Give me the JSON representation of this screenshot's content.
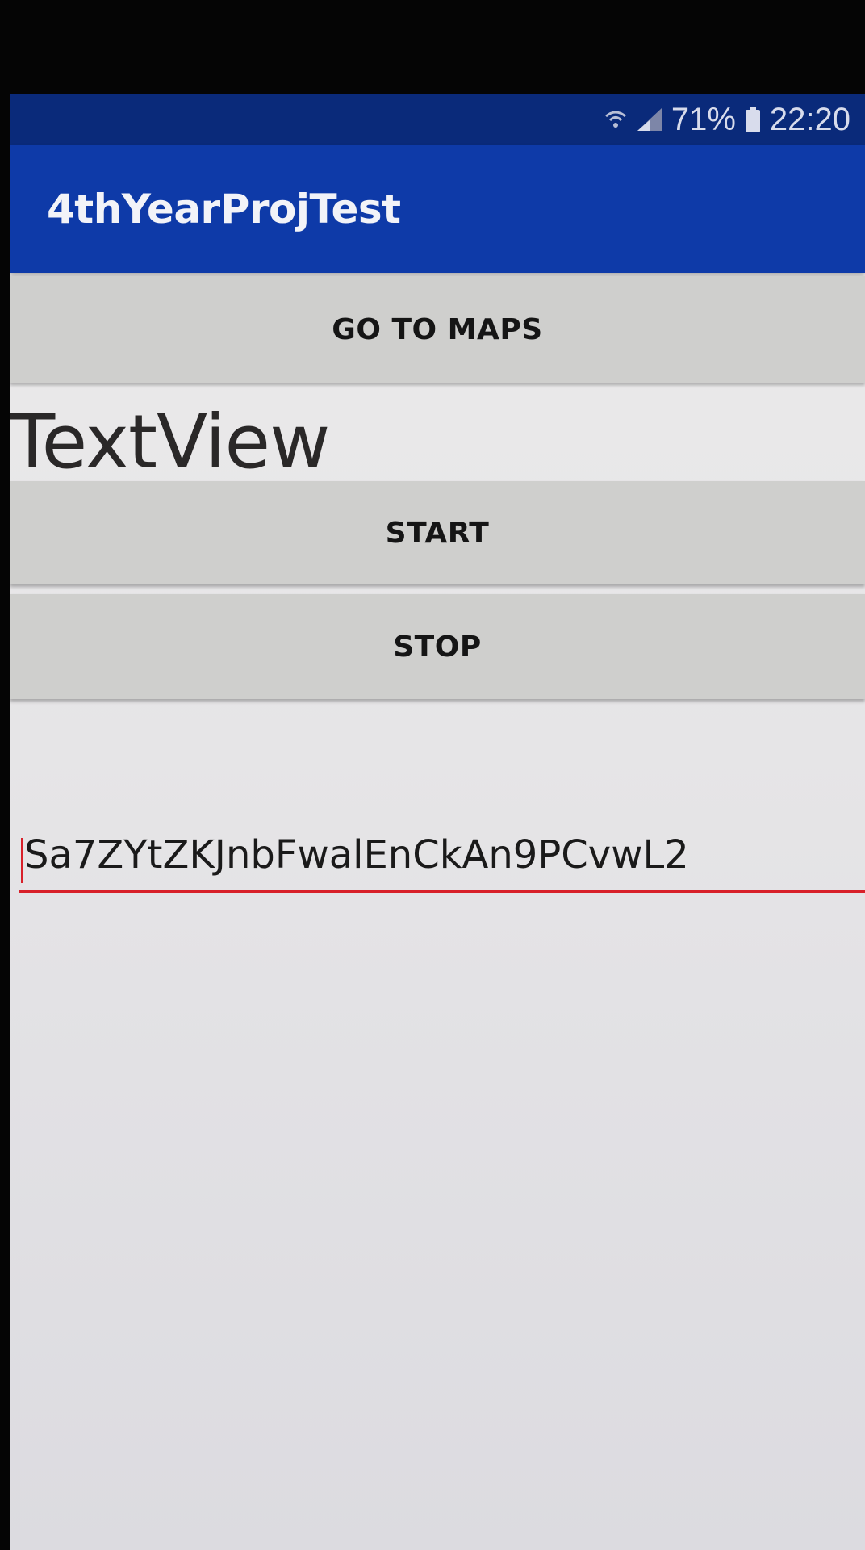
{
  "status_bar": {
    "battery_percent": "71%",
    "time": "22:20",
    "icons": [
      "wifi-icon",
      "signal-icon",
      "battery-icon"
    ]
  },
  "app_bar": {
    "title": "4thYearProjTest"
  },
  "buttons": {
    "go_to_maps": "GO TO MAPS",
    "start": "START",
    "stop": "STOP"
  },
  "textview": {
    "text": "TextView"
  },
  "edit_field": {
    "value": "Sa7ZYtZKJnbFwalEnCkAn9PCvwL2"
  },
  "colors": {
    "status_bar": "#0a2a7a",
    "app_bar": "#0e3aa8",
    "button_bg": "#cfcfcd",
    "field_underline": "#d8202a"
  }
}
